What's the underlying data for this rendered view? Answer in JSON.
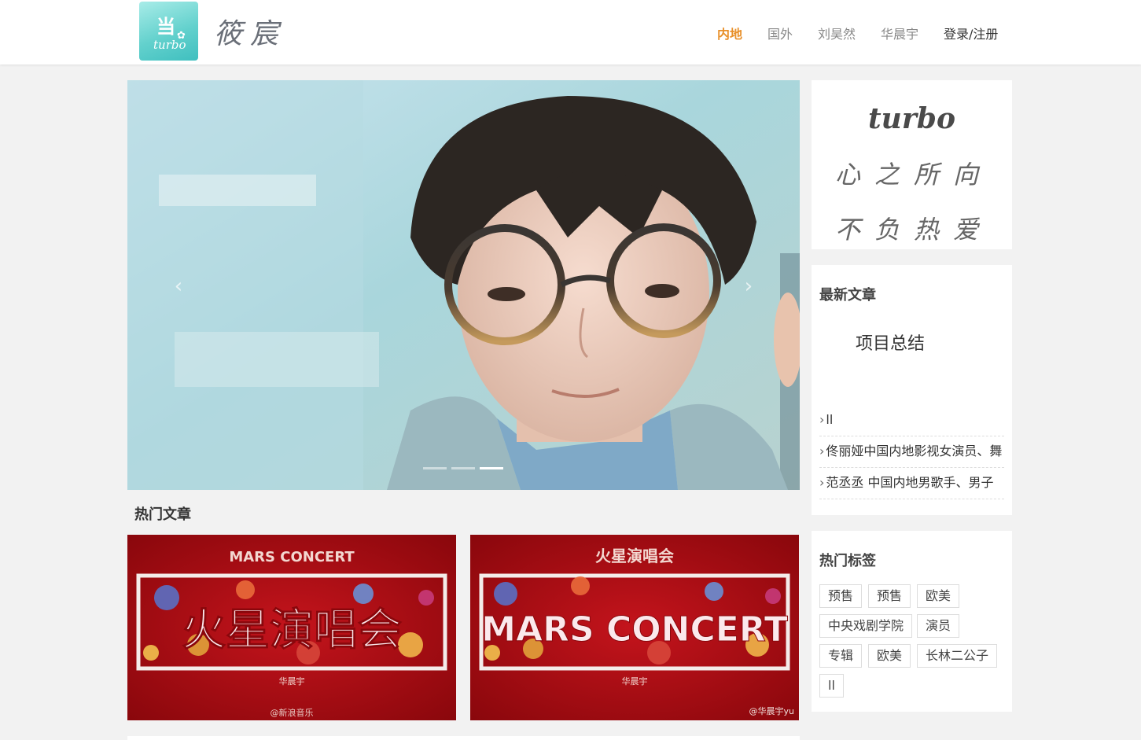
{
  "header": {
    "logo_word": "turbo",
    "logo_glyph": "当",
    "brand": "筱宸",
    "nav": [
      {
        "label": "内地",
        "active": true
      },
      {
        "label": "国外",
        "active": false
      },
      {
        "label": "刘昊然",
        "active": false
      },
      {
        "label": "华晨宇",
        "active": false
      },
      {
        "label": "登录/注册",
        "active": false
      }
    ]
  },
  "carousel": {
    "prev_icon": "‹",
    "next_icon": "›",
    "slide_count": 3,
    "active_index": 2
  },
  "hot_articles": {
    "title": "热门文章",
    "posters": [
      {
        "top_text": "MARS CONCERT",
        "main_text": "火星演唱会",
        "artist": "华晨宇",
        "watermark": "@新浪音乐"
      },
      {
        "top_text": "火星演唱会",
        "main_text": "MARS CONCERT",
        "artist": "华晨宇",
        "watermark": "@华晨宇yu"
      }
    ]
  },
  "sidebar": {
    "motto": {
      "title": "turbo",
      "line1": "心之所向",
      "line2": "不负热爱"
    },
    "latest": {
      "title": "最新文章",
      "feature": "项目总结",
      "items": [
        "ll",
        "佟丽娅中国内地影视女演员、舞",
        "范丞丞 中国内地男歌手、男子"
      ]
    },
    "tags": {
      "title": "热门标签",
      "items": [
        "预售",
        "预售",
        "欧美",
        "中央戏剧学院",
        "演员",
        "专辑",
        "欧美",
        "长林二公子",
        "ll"
      ]
    }
  },
  "colors": {
    "accent": "#e8902a",
    "poster_red": "#a30c12",
    "logo_teal": "#63d1cd"
  }
}
